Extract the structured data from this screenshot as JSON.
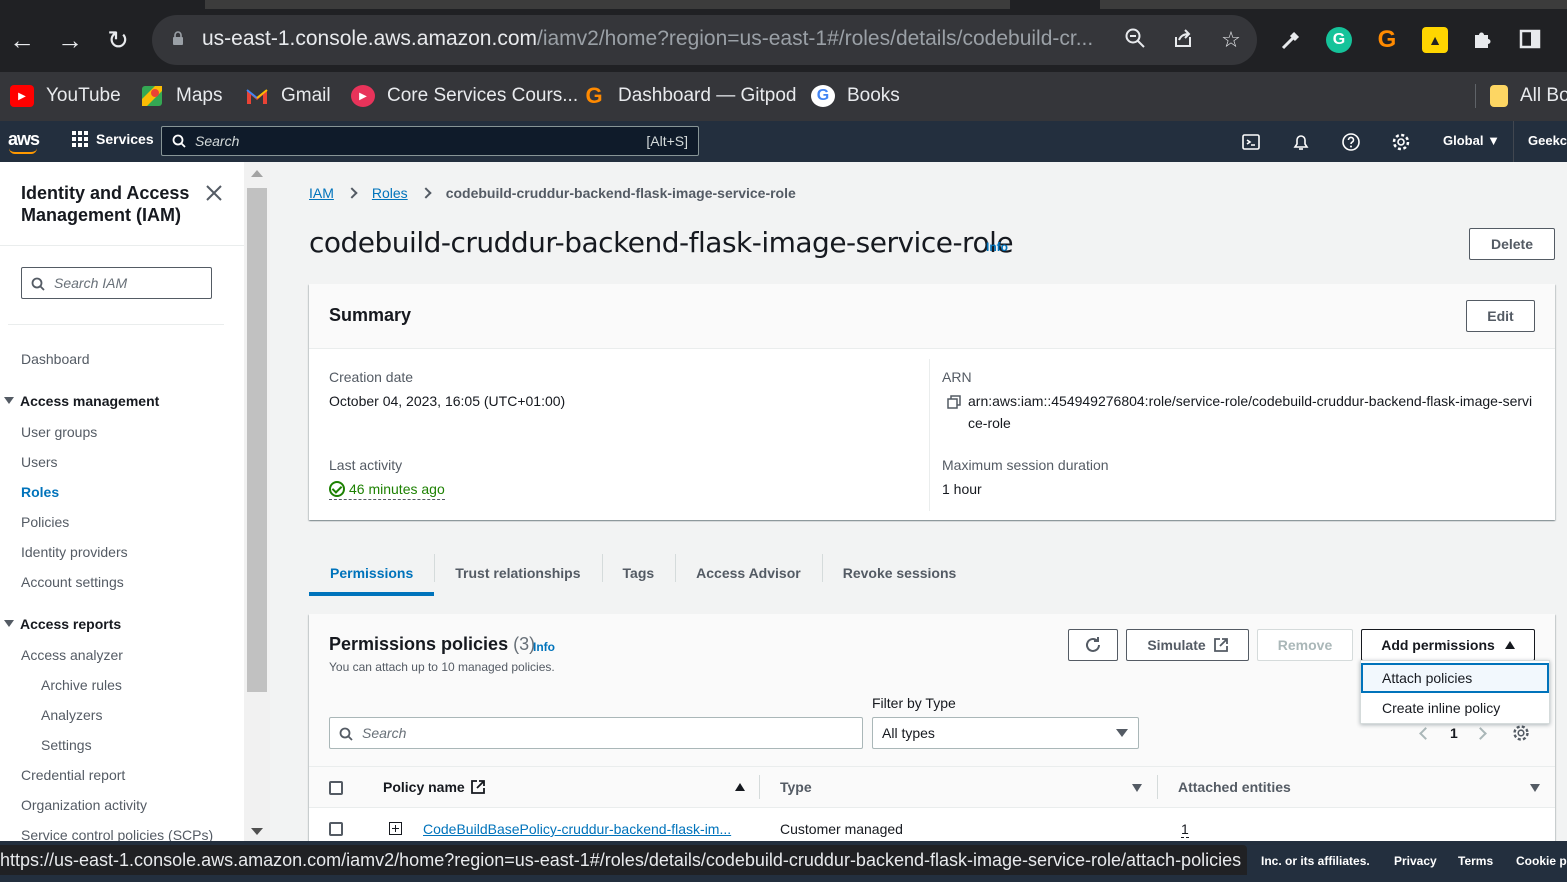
{
  "browser": {
    "url_host": "us-east-1.console.aws.amazon.com",
    "url_path": "/iamv2/home?region=us-east-1#/roles/details/codebuild-cr...",
    "status_url": "https://us-east-1.console.aws.amazon.com/iamv2/home?region=us-east-1#/roles/details/codebuild-cruddur-backend-flask-image-service-role/attach-policies",
    "bookmarks": [
      {
        "label": "YouTube",
        "icon": "youtube-icon"
      },
      {
        "label": "Maps",
        "icon": "maps-icon"
      },
      {
        "label": "Gmail",
        "icon": "gmail-icon"
      },
      {
        "label": "Core Services Cours...",
        "icon": "course-icon"
      },
      {
        "label": "Dashboard — Gitpod",
        "icon": "gitpod-icon"
      },
      {
        "label": "Books",
        "icon": "google-icon"
      }
    ],
    "bookmarks_right": "All Bo"
  },
  "aws_header": {
    "logo": "aws",
    "services": "Services",
    "search_placeholder": "Search",
    "search_shortcut": "[Alt+S]",
    "region": "Global",
    "account": "Geekch"
  },
  "sidebar": {
    "title": "Identity and Access Management (IAM)",
    "search_placeholder": "Search IAM",
    "dashboard": "Dashboard",
    "access_management": "Access management",
    "access_management_items": [
      "User groups",
      "Users",
      "Roles",
      "Policies",
      "Identity providers",
      "Account settings"
    ],
    "access_reports": "Access reports",
    "access_analyzer": "Access analyzer",
    "analyzer_items": [
      "Archive rules",
      "Analyzers",
      "Settings"
    ],
    "report_items": [
      "Credential report",
      "Organization activity",
      "Service control policies (SCPs)"
    ]
  },
  "breadcrumb": {
    "iam": "IAM",
    "roles": "Roles",
    "current": "codebuild-cruddur-backend-flask-image-service-role"
  },
  "page": {
    "title": "codebuild-cruddur-backend-flask-image-service-role",
    "info": "Info",
    "delete": "Delete"
  },
  "summary": {
    "title": "Summary",
    "edit": "Edit",
    "creation_date_label": "Creation date",
    "creation_date": "October 04, 2023, 16:05 (UTC+01:00)",
    "last_activity_label": "Last activity",
    "last_activity": "46 minutes ago",
    "arn_label": "ARN",
    "arn": "arn:aws:iam::454949276804:role/service-role/codebuild-cruddur-backend-flask-image-service-role",
    "max_session_label": "Maximum session duration",
    "max_session": "1 hour"
  },
  "tabs": [
    "Permissions",
    "Trust relationships",
    "Tags",
    "Access Advisor",
    "Revoke sessions"
  ],
  "permissions": {
    "title": "Permissions policies",
    "count": "(3)",
    "info": "Info",
    "description": "You can attach up to 10 managed policies.",
    "simulate": "Simulate",
    "remove": "Remove",
    "add_permissions": "Add permissions",
    "menu": [
      "Attach policies",
      "Create inline policy"
    ],
    "filter_label": "Filter by Type",
    "search_placeholder": "Search",
    "type_selected": "All types",
    "page": "1",
    "columns": {
      "name": "Policy name",
      "type": "Type",
      "entities": "Attached entities"
    },
    "rows": [
      {
        "name": "CodeBuildBasePolicy-cruddur-backend-flask-im...",
        "type": "Customer managed",
        "entities": "1"
      }
    ]
  },
  "footer": {
    "copyright_tail": "Inc. or its affiliates.",
    "privacy": "Privacy",
    "terms": "Terms",
    "cookie": "Cookie pr"
  },
  "colors": {
    "aws_nav": "#232f3e",
    "link": "#0073bb",
    "success": "#1d8102",
    "aws_orange": "#ff9900"
  }
}
